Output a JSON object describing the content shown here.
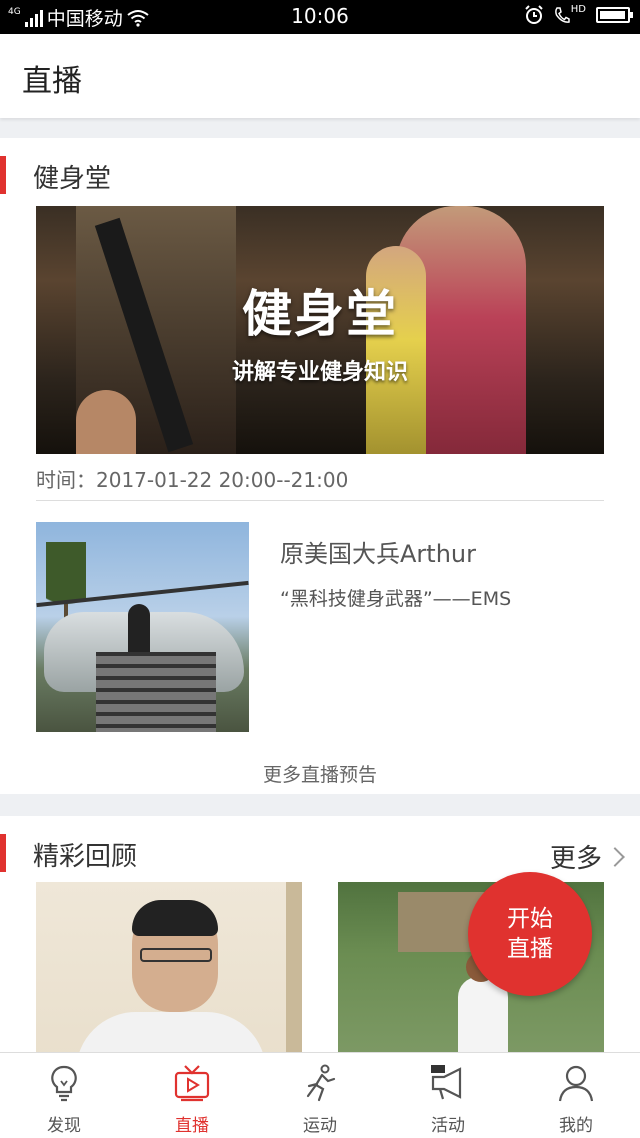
{
  "status_bar": {
    "network_type": "4G",
    "carrier": "中国移动",
    "time": "10:06",
    "hd_label": "HD",
    "battery_level": 0.95
  },
  "header": {
    "title": "直播"
  },
  "live_section": {
    "title": "健身堂",
    "banner_title": "健身堂",
    "banner_subtitle": "讲解专业健身知识",
    "time_text": "时间：2017-01-22 20:00--21:00",
    "host_name": "原美国大兵Arthur",
    "host_desc": "“黑科技健身武器”——EMS",
    "more_link": "更多直播预告"
  },
  "replay_section": {
    "title": "精彩回顾",
    "more_label": "更多"
  },
  "fab": {
    "line1": "开始",
    "line2": "直播"
  },
  "nav": {
    "items": [
      {
        "label": "发现",
        "icon": "lightbulb-icon"
      },
      {
        "label": "直播",
        "icon": "tv-icon"
      },
      {
        "label": "运动",
        "icon": "runner-icon"
      },
      {
        "label": "活动",
        "icon": "megaphone-icon"
      },
      {
        "label": "我的",
        "icon": "person-icon"
      }
    ],
    "active_index": 1
  },
  "colors": {
    "accent": "#e0322f",
    "background": "#eef0f3"
  }
}
